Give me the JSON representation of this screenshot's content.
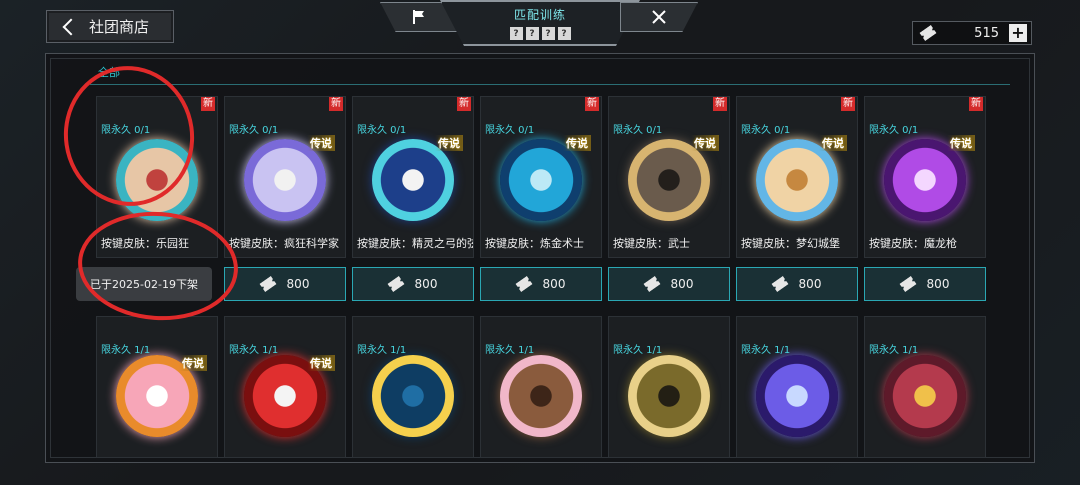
{
  "header": {
    "back_label": "社团商店",
    "mode_title": "匹配训练",
    "mode_marks": [
      "?",
      "?",
      "?",
      "?"
    ],
    "currency_value": "515",
    "plus_label": "+"
  },
  "shop": {
    "tab_label": "全部",
    "row1": [
      {
        "limit": "限永久 0/1",
        "name": "按键皮肤：乐园狂",
        "badge": "新",
        "legend": "",
        "colors": [
          "#e7c6a6",
          "#3ab4c2",
          "#c0423e"
        ]
      },
      {
        "limit": "限永久 0/1",
        "name": "按键皮肤：疯狂科学家",
        "badge": "新",
        "legend": "传说",
        "colors": [
          "#c9c3f2",
          "#7a6ad8",
          "#f1f1f1"
        ]
      },
      {
        "limit": "限永久 0/1",
        "name": "按键皮肤：精灵之弓的弦",
        "badge": "新",
        "legend": "传说",
        "colors": [
          "#1d3f8a",
          "#4fd1e0",
          "#f3f3f3"
        ]
      },
      {
        "limit": "限永久 0/1",
        "name": "按键皮肤：炼金术士",
        "badge": "新",
        "legend": "传说",
        "colors": [
          "#22a6d8",
          "#0f3f6e",
          "#bde9f6"
        ]
      },
      {
        "limit": "限永久 0/1",
        "name": "按键皮肤：武士",
        "badge": "新",
        "legend": "传说",
        "colors": [
          "#6a5b4c",
          "#d7b470",
          "#231f1b"
        ]
      },
      {
        "limit": "限永久 0/1",
        "name": "按键皮肤：梦幻城堡",
        "badge": "新",
        "legend": "传说",
        "colors": [
          "#f0d3a5",
          "#63b6e6",
          "#c68840"
        ]
      },
      {
        "limit": "限永久 0/1",
        "name": "按键皮肤：魔龙枪",
        "badge": "新",
        "legend": "传说",
        "colors": [
          "#b04be6",
          "#4a1670",
          "#f4d7ff"
        ]
      }
    ],
    "row2": [
      {
        "limit": "限永久 1/1",
        "legend": "传说",
        "colors": [
          "#f7a6b8",
          "#e98b2b",
          "#ffffff"
        ]
      },
      {
        "limit": "限永久 1/1",
        "legend": "传说",
        "colors": [
          "#e02f2f",
          "#7a0f0f",
          "#f4f4f4"
        ]
      },
      {
        "limit": "限永久 1/1",
        "legend": "",
        "colors": [
          "#0e3d63",
          "#f5d04d",
          "#1f6ea4"
        ]
      },
      {
        "limit": "限永久 1/1",
        "legend": "",
        "colors": [
          "#8a5b3d",
          "#f1b7c9",
          "#3d2518"
        ]
      },
      {
        "limit": "限永久 1/1",
        "legend": "",
        "colors": [
          "#7a6a2b",
          "#e8d089",
          "#231f14"
        ]
      },
      {
        "limit": "限永久 1/1",
        "legend": "",
        "colors": [
          "#6c5ce7",
          "#2b1a6b",
          "#c8d9ff"
        ]
      },
      {
        "limit": "限永久 1/1",
        "legend": "",
        "colors": [
          "#b43a4d",
          "#5e1a2a",
          "#f0c04a"
        ]
      }
    ],
    "expired_label": "已于2025-02-19下架",
    "price": "800"
  }
}
